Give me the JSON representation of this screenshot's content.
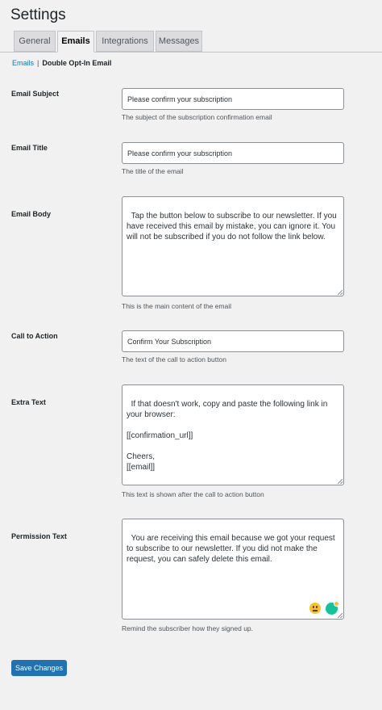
{
  "page_title": "Settings",
  "tabs": [
    {
      "label": "General",
      "active": false
    },
    {
      "label": "Emails",
      "active": true
    },
    {
      "label": "Integrations",
      "active": false
    },
    {
      "label": "Messages",
      "active": false
    }
  ],
  "breadcrumb": {
    "link": "Emails",
    "separator": "|",
    "current": "Double Opt-In Email"
  },
  "fields": {
    "email_subject": {
      "label": "Email Subject",
      "value": "Please confirm your subscription",
      "description": "The subject of the subscription confirmation email"
    },
    "email_title": {
      "label": "Email Title",
      "value": "Please confirm your subscription",
      "description": "The title of the email"
    },
    "email_body": {
      "label": "Email Body",
      "value": "Tap the button below to subscribe to our newsletter. If you have received this email by mistake, you can ignore it. You will not be subscribed if you do not follow the link below.",
      "description": "This is the main content of the email"
    },
    "call_to_action": {
      "label": "Call to Action",
      "value": "Confirm Your Subscription",
      "description": "The text of the call to action button"
    },
    "extra_text": {
      "label": "Extra Text",
      "value": "If that doesn't work, copy and paste the following link in your browser:\n\n[[confirmation_url]]\n\nCheers,\n[[email]]",
      "description": "This text is shown after the call to action button"
    },
    "permission_text": {
      "label": "Permission Text",
      "value": "You are receiving this email because we got your request to subscribe to our newsletter. If you did not make the request, you can safely delete this email.",
      "description": "Remind the subscriber how they signed up."
    }
  },
  "icons": {
    "emoji": "emoji-smiley-icon",
    "grammarly": "grammarly-icon",
    "grammarly_letter": "G"
  },
  "save_button": "Save Changes",
  "colors": {
    "accent": "#2271b1",
    "background": "#f1f1f1",
    "grammarly": "#15c39a"
  }
}
